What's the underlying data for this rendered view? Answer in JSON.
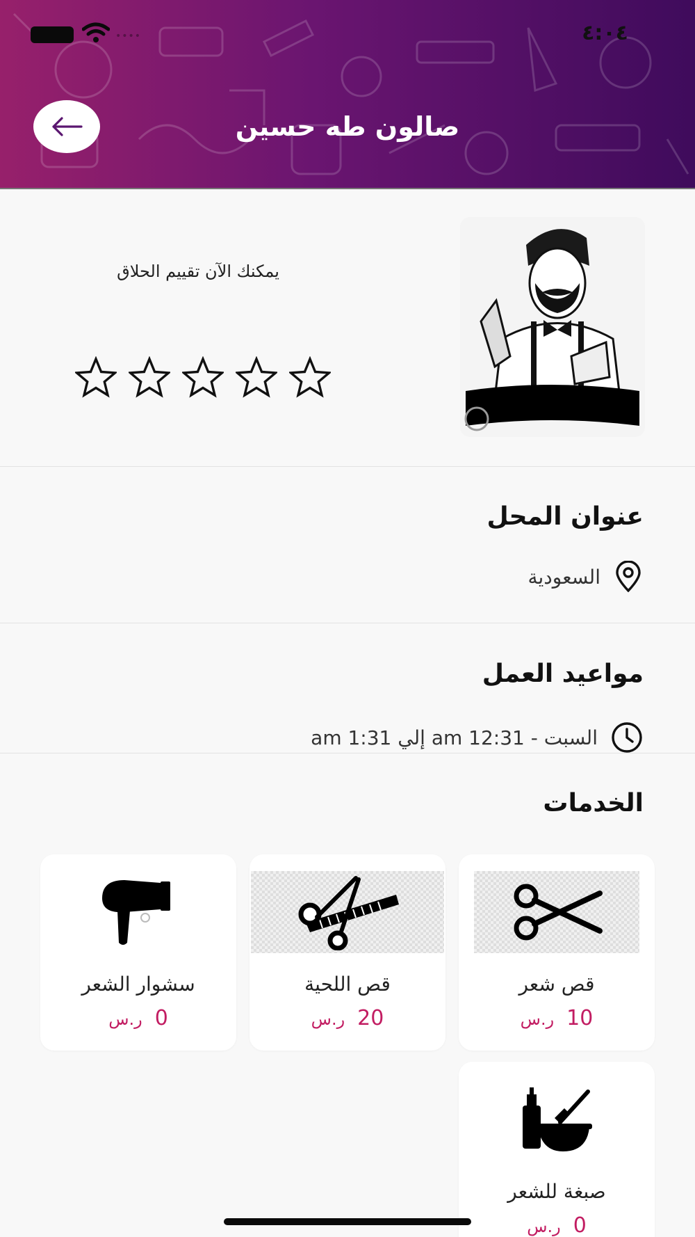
{
  "status": {
    "time": "٤:٠٤",
    "carrier": "••••"
  },
  "header": {
    "title": "صالون طه حسين",
    "back_icon": "arrow-left-icon"
  },
  "profile": {
    "rate_prompt": "يمكنك الآن تقييم الحلاق",
    "rating": {
      "value": 0,
      "max": 5
    },
    "avatar_icon": "barber-illustration"
  },
  "address": {
    "title": "عنوان المحل",
    "icon": "location-pin-icon",
    "value": "السعودية"
  },
  "hours": {
    "title": "مواعيد العمل",
    "icon": "clock-icon",
    "value": "السبت - am 12:31 إلي am 1:31"
  },
  "services": {
    "title": "الخدمات",
    "currency": "ر.س",
    "items": [
      {
        "name": "قص شعر",
        "price": "10",
        "icon": "scissors-icon"
      },
      {
        "name": "قص اللحية",
        "price": "20",
        "icon": "scissors-comb-icon"
      },
      {
        "name": "سشوار الشعر",
        "price": "0",
        "icon": "hair-dryer-icon"
      },
      {
        "name": "صبغة للشعر",
        "price": "0",
        "icon": "hair-dye-icon"
      }
    ]
  },
  "colors": {
    "header_start": "#97206b",
    "header_end": "#3f0b5c",
    "price": "#c21d62"
  }
}
